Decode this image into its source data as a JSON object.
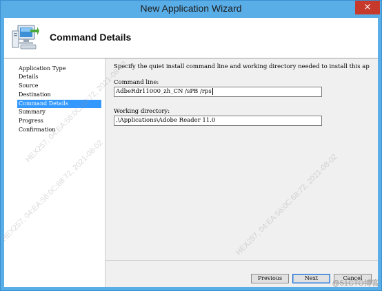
{
  "window": {
    "title": "New Application Wizard",
    "close_glyph": "×"
  },
  "header": {
    "title": "Command Details",
    "icon": "computer-install-icon"
  },
  "nav": {
    "items": [
      {
        "label": "Application Type"
      },
      {
        "label": "Details"
      },
      {
        "label": "Source"
      },
      {
        "label": "Destination"
      },
      {
        "label": "Command Details"
      },
      {
        "label": "Summary"
      },
      {
        "label": "Progress"
      },
      {
        "label": "Confirmation"
      }
    ],
    "active_index": 4
  },
  "content": {
    "intro": "Specify the quiet install command line and working directory needed to install this ap",
    "command_line_label": "Command line:",
    "command_line_value": "AdbeRdr11000_zh_CN /sPB /rps",
    "working_dir_label": "Working directory:",
    "working_dir_value": ".\\Applications\\Adobe Reader 11.0"
  },
  "buttons": {
    "previous": "Previous",
    "next": "Next",
    "cancel": "Cancel"
  },
  "watermark": {
    "lines": [
      "HEX257, 04:EA:56:0C:68:72, 2021-08-02",
      "HEX257, 04:EA:56:0C:68:72, 2021-08-02",
      "HEX257, 04:EA:56:0C:68:72, 2021-08-02"
    ],
    "badge": "@51CTO博客"
  },
  "colors": {
    "titlebar": "#5aaee8",
    "selection": "#3399ff",
    "close": "#c7392b"
  }
}
